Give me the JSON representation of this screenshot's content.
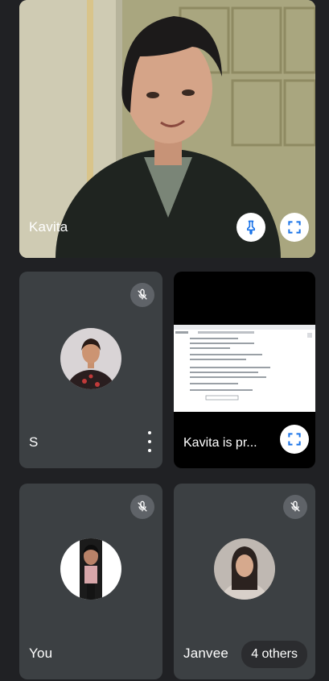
{
  "main_tile": {
    "name": "Kavita",
    "pin_icon": "pin-icon",
    "fullscreen_icon": "fullscreen-icon"
  },
  "tiles": {
    "s": {
      "name": "S",
      "muted_icon": "mic-off-icon",
      "more_icon": "more-vert-icon"
    },
    "presentation": {
      "label": "Kavita is pr...",
      "fullscreen_icon": "fullscreen-icon"
    },
    "you": {
      "name": "You",
      "muted_icon": "mic-off-icon"
    },
    "janvee": {
      "name": "Janvee",
      "muted_icon": "mic-off-icon",
      "others_label": "4 others"
    }
  },
  "colors": {
    "background": "#202124",
    "tile": "#3c4043",
    "accent_blue": "#1a73e8",
    "mute_chip": "#5f6368"
  }
}
